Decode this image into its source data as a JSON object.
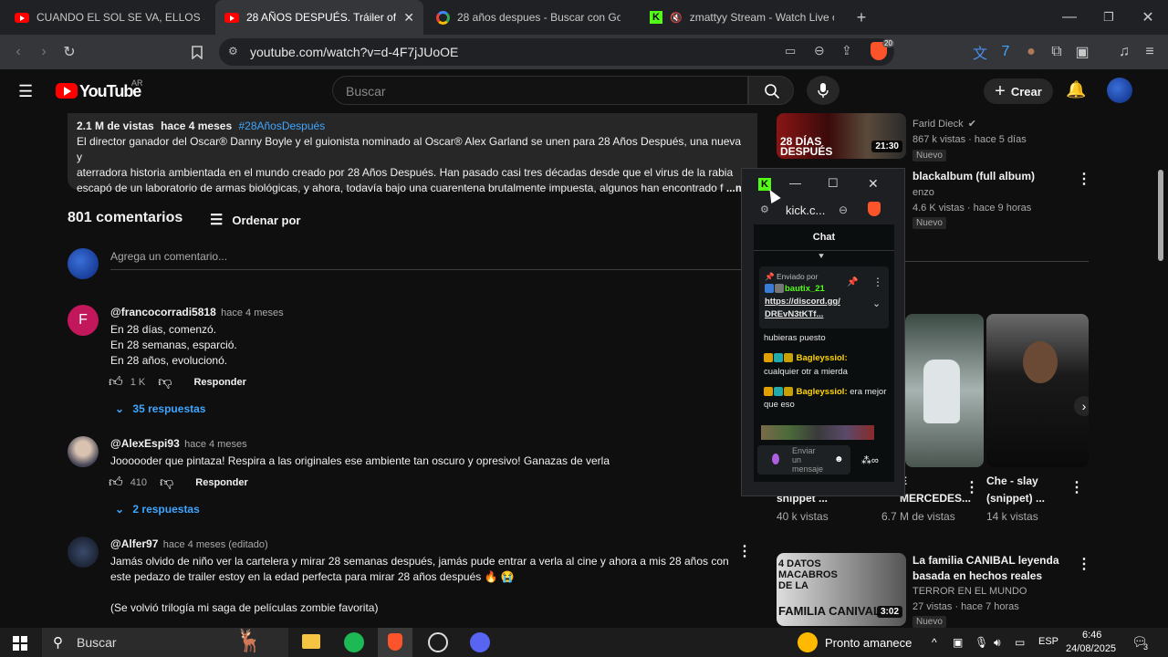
{
  "browser": {
    "tabs": [
      {
        "label": "CUANDO EL SOL SE VA, ELLOS SALEN",
        "icon": "youtube-icon"
      },
      {
        "label": "28 AÑOS DESPUÉS. Tráiler oficial",
        "icon": "youtube-icon"
      },
      {
        "label": "28 años despues - Buscar con Google",
        "icon": "google-icon"
      },
      {
        "label": "zmattyy Stream - Watch Live on K",
        "icon": "kick-icon"
      }
    ],
    "url": "youtube.com/watch?v=d-4F7jJUoOE",
    "extension_badge": "20"
  },
  "youtube": {
    "logo_text": "YouTube",
    "region": "AR",
    "search_placeholder": "Buscar",
    "create_label": "Crear",
    "description": {
      "views": "2.1 M de vistas",
      "age": "hace 4 meses",
      "hashtag": "#28AñosDespués",
      "line1": "El director ganador del Oscar® Danny Boyle y el guionista nominado al Oscar® Alex Garland se unen para 28 Años Después, una nueva y",
      "line2": "aterradora historia ambientada en el mundo creado por 28 Años Después. Han pasado casi tres décadas desde que el virus de la rabia",
      "line3": "escapó de un laboratorio de armas biológicas, y ahora, todavía bajo una cuarentena brutalmente impuesta, algunos han encontrado f",
      "more": "...más"
    },
    "comments_header": {
      "count": "801 comentarios",
      "sort_label": "Ordenar por"
    },
    "add_comment_placeholder": "Agrega un comentario...",
    "comments": [
      {
        "user": "@francocorradi5818",
        "when": "hace 4 meses",
        "initial": "F",
        "lines": [
          "En 28 días, comenzó.",
          "En 28 semanas, esparció.",
          "En 28 años, evolucionó."
        ],
        "likes": "1 K",
        "reply_label": "Responder",
        "replies": "35 respuestas"
      },
      {
        "user": "@AlexEspi93",
        "when": "hace 4 meses",
        "lines": [
          "Joooooder que pintaza! Respira a las originales ese ambiente tan oscuro y opresivo! Ganazas de verla"
        ],
        "likes": "410",
        "reply_label": "Responder",
        "replies": "2 respuestas"
      },
      {
        "user": "@Alfer97",
        "when": "hace 4 meses (editado)",
        "lines": [
          "Jamás olvido de niño ver la cartelera y mirar 28 semanas después, jamás pude entrar a verla al cine y ahora a mis 28 años con",
          "este pedazo de trailer estoy en la edad perfecta para mirar 28 años después 🔥 😭",
          "",
          "(Se volvió trilogía mi saga de películas zombie favorita)"
        ]
      }
    ],
    "sidebar": {
      "videos": [
        {
          "channel": "Farid Dieck",
          "meta": "867 k vistas · hace 5 días",
          "badge": "Nuevo",
          "duration": "21:30",
          "thumb_text": "28 DÍAS DESPUÉS"
        },
        {
          "title": "blackalbum (full album)",
          "channel": "enzo",
          "meta": "4.6 K vistas · hace 9 horas",
          "badge": "Nuevo"
        },
        {
          "title": "La familia CANIBAL leyenda basada en hechos reales",
          "channel": "TERROR EN EL MUNDO",
          "meta": "27 vistas · hace 7 horas",
          "badge": "Nuevo",
          "duration": "3:02",
          "thumb_text_1": "4 DATOS MACABROS DE LA",
          "thumb_text_2": "FAMILIA CANIVAL"
        }
      ],
      "shorts": [
        {
          "title": "snippet ...",
          "views": "40 k vistas"
        },
        {
          "title": "E MERCEDES...",
          "views": "6.7 M de vistas"
        },
        {
          "title": "Che - slay (snippet) ...",
          "views": "14 k vistas"
        }
      ]
    }
  },
  "kick_popup": {
    "url": "kick.c...",
    "tab": "Chat",
    "pinned_label": "Enviado por",
    "pinned_user": "bautix_21",
    "pinned_link_1": "https://discord.gg/",
    "pinned_link_2": "DREvN3tKTf...",
    "messages": [
      {
        "user": "",
        "text": "hubieras puesto"
      },
      {
        "user": "Bagleyssiol:",
        "text": "cualquier otr a mierda"
      },
      {
        "user": "Bagleyssiol:",
        "text": "era mejor que eso"
      }
    ],
    "input_placeholder": "Enviar un mensaje"
  },
  "taskbar": {
    "search_label": "Buscar",
    "weather": "Pronto amanece",
    "lang": "ESP",
    "time": "6:46",
    "date": "24/08/2025",
    "notif_count": "3"
  }
}
